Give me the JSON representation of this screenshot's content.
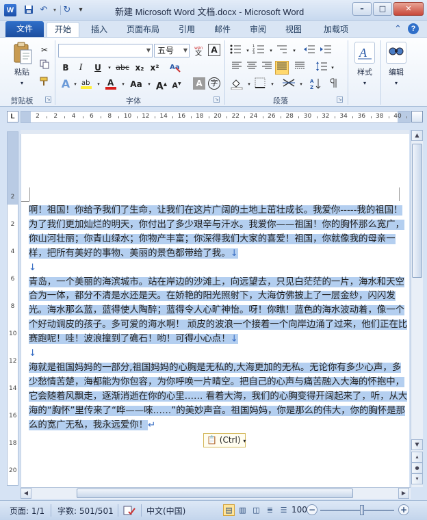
{
  "window": {
    "title": "新建 Microsoft Word 文档.docx - Microsoft Word",
    "logo_letter": "W",
    "min_label": "–",
    "max_label": "□",
    "close_label": "✕"
  },
  "quick_access": {
    "items": [
      "save-icon",
      "undo-icon",
      "redo-icon",
      "customize-icon"
    ]
  },
  "ribbon_tabs": {
    "file": "文件",
    "tabs": [
      "开始",
      "插入",
      "页面布局",
      "引用",
      "邮件",
      "审阅",
      "视图",
      "加载项"
    ],
    "active_index": 0,
    "help": "?"
  },
  "clipboard_group": {
    "paste_label": "粘贴",
    "label": "剪贴板"
  },
  "font_group": {
    "font_name_value": "",
    "font_size_value": "五号",
    "bold": "B",
    "italic": "I",
    "underline": "U",
    "strike": "abc",
    "subscript": "x₂",
    "superscript": "x²",
    "grow": "A",
    "case": "Aa",
    "label": "字体"
  },
  "paragraph_group": {
    "label": "段落"
  },
  "styles_group": {
    "label": "样式"
  },
  "editing_group": {
    "label": "编辑"
  },
  "ruler": {
    "corner": "L",
    "numbers": [
      "2",
      "2",
      "4",
      "6",
      "8",
      "10",
      "12",
      "14",
      "16",
      "18",
      "20",
      "22",
      "24",
      "26",
      "28",
      "30",
      "32",
      "34",
      "36",
      "38",
      "40"
    ]
  },
  "vruler": {
    "numbers": [
      "2",
      "2",
      "4",
      "6",
      "8",
      "10",
      "12",
      "14",
      "16",
      "18",
      "20"
    ]
  },
  "document": {
    "paragraphs": [
      "啊！祖国！你给予我们了生命，让我们在这片广阔的土地上茁壮成长。我爱你-----我的祖国！为了我们更加灿烂的明天，你付出了多少艰辛与汗水。我爱你——祖国！你的胸怀那么宽广，你山河壮丽；你青山绿水；你物产丰富；你深得我们大家的喜爱！祖国，你就像我的母亲一样，把所有美好的事物、美丽的景色都带给了我。",
      "",
      "青岛，一个美丽的海滨城市。站在岸边的沙滩上，向远望去，只见白茫茫的一片，海水和天空合为一体，都分不清是水还是天。在娇艳的阳光照射下，大海仿佛披上了一层金纱，闪闪发光。海水那么蓝，蓝得使人陶醉；蓝得令人心旷神怡。呀！你瞧！蓝色的海水波动着，像一个个好动调皮的孩子。多可爱的海水啊！  顽皮的波浪一个接着一个向岸边涌了过来，他们正在比赛跑呢！哇！波浪撞到了礁石！哟！可得小心点！",
      "",
      "海就是祖国妈妈的一部分,祖国妈妈的心胸是无私的,大海更加的无私。无论你有多少心声，多少愁情苦楚，海都能为你包容，为你呼唤一片晴空。把自己的心声与痛苦融入大海的怀抱中，它会随着风飘走，逐渐消逝在你的心里……  看着大海，我们的心胸变得开阔起来了，听，从大海的“胸怀”里传来了“哗——唻……”的美妙声音。祖国妈妈，你是那么的伟大，你的胸怀是那么的宽广无私，我永远爱你！"
    ],
    "paragraph_mark": "↓",
    "paste_options": "(Ctrl)"
  },
  "statusbar": {
    "page": "页面: 1/1",
    "words": "字数: 501/501",
    "language": "中文(中国)",
    "zoom": "100%",
    "zoom_level": 1.0
  },
  "colors": {
    "selection": "#b4cff0",
    "file_tab": "#2f6fc9",
    "ribbon_bg": "#d9e5f4"
  }
}
